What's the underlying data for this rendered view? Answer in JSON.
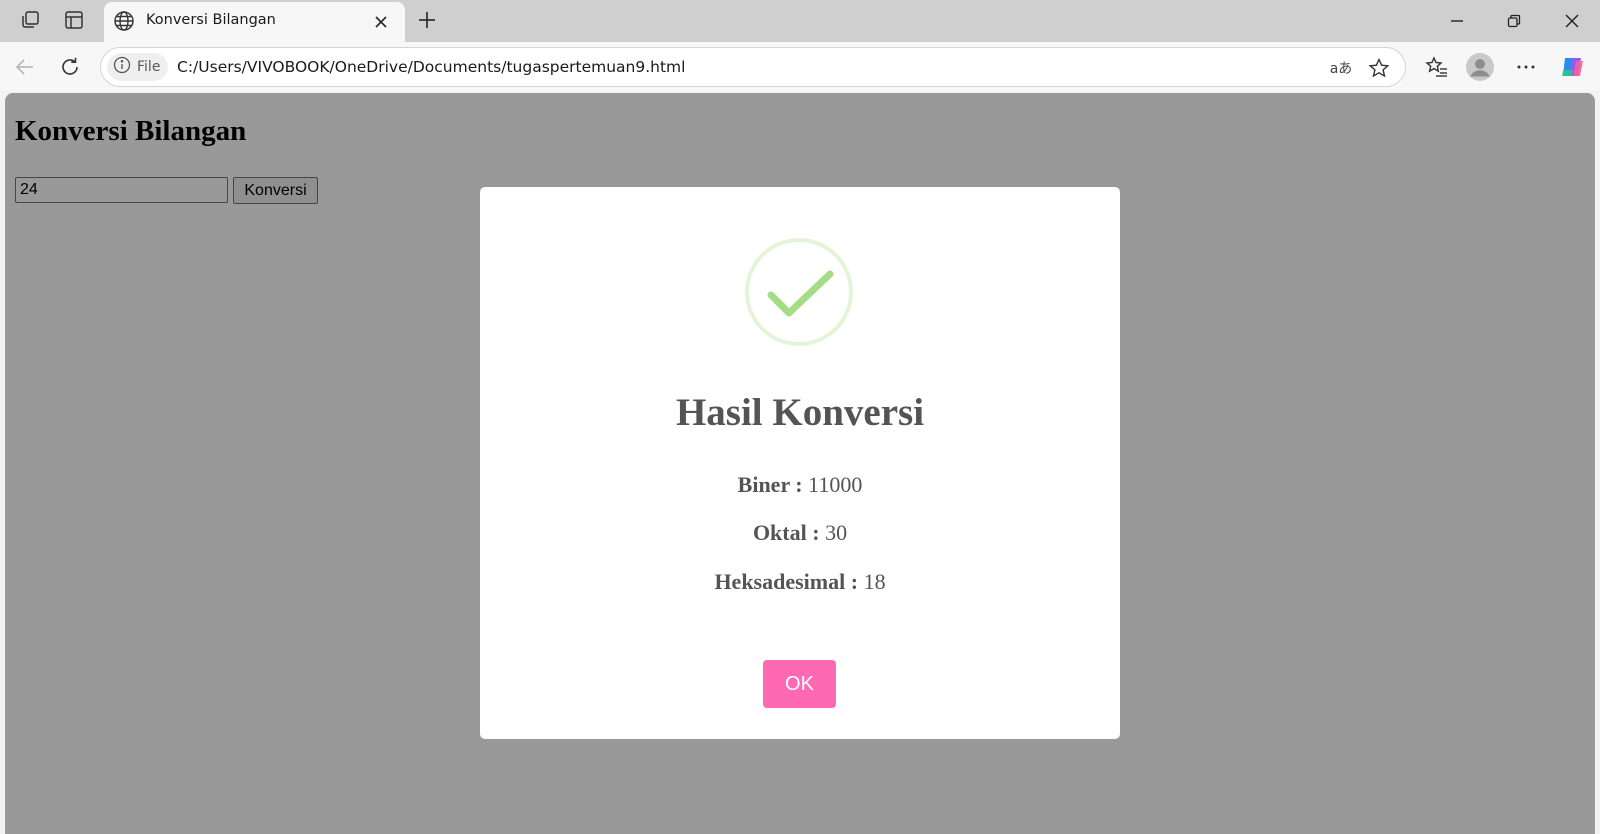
{
  "browser": {
    "tab_title": "Konversi Bilangan",
    "site_chip_label": "File",
    "url": "C:/Users/VIVOBOOK/OneDrive/Documents/tugaspertemuan9.html",
    "read_aloud_glyph": "aあ"
  },
  "page": {
    "title": "Konversi Bilangan",
    "input_value": "24",
    "convert_button_label": "Konversi"
  },
  "modal": {
    "icon": "success-check-icon",
    "title": "Hasil Konversi",
    "results": [
      {
        "label": "Biner :",
        "value": "11000"
      },
      {
        "label": "Oktal :",
        "value": "30"
      },
      {
        "label": "Heksadesimal :",
        "value": "18"
      }
    ],
    "ok_label": "OK",
    "colors": {
      "ok_button": "#ff69b4",
      "check": "#a5dc86",
      "check_ring": "#e3f4d9"
    }
  }
}
